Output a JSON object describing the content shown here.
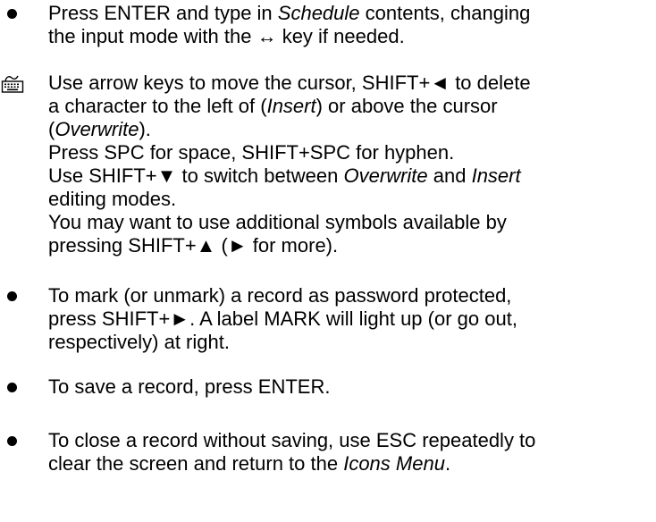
{
  "items": [
    {
      "kind": "bullet",
      "lines": [
        [
          {
            "t": "Press ENTER and type in "
          },
          {
            "t": "Schedule",
            "i": true
          },
          {
            "t": " contents, changing"
          }
        ],
        [
          {
            "t": "the input mode with the ↔ key if needed."
          }
        ]
      ]
    },
    {
      "kind": "keyboard",
      "icon": "keyboard-icon",
      "lines": [
        [
          {
            "t": "Use arrow keys to move the cursor, SHIFT+◄ to delete"
          }
        ],
        [
          {
            "t": "a character to the left of ("
          },
          {
            "t": "Insert",
            "i": true
          },
          {
            "t": ") or above the cursor"
          }
        ],
        [
          {
            "t": "("
          },
          {
            "t": "Overwrite",
            "i": true
          },
          {
            "t": ")."
          }
        ],
        [
          {
            "t": "Press SPC for space, SHIFT+SPC for hyphen."
          }
        ],
        [
          {
            "t": "Use SHIFT+▼ to switch between "
          },
          {
            "t": "Overwrite",
            "i": true
          },
          {
            "t": " and "
          },
          {
            "t": "Insert",
            "i": true
          }
        ],
        [
          {
            "t": "editing modes."
          }
        ],
        [
          {
            "t": "You may want to use additional symbols available by"
          }
        ],
        [
          {
            "t": "pressing SHIFT+▲ (► for more)."
          }
        ]
      ]
    },
    {
      "kind": "bullet",
      "lines": [
        [
          {
            "t": "To mark (or unmark) a record as password protected,"
          }
        ],
        [
          {
            "t": "press SHIFT+►. A label MARK will light up (or go out,"
          }
        ],
        [
          {
            "t": "respectively) at right."
          }
        ]
      ]
    },
    {
      "kind": "bullet",
      "lines": [
        [
          {
            "t": "To save a record, press ENTER."
          }
        ]
      ]
    },
    {
      "kind": "bullet",
      "lines": [
        [
          {
            "t": "To close a record without saving, use ESC repeatedly to"
          }
        ],
        [
          {
            "t": "clear the screen and return to the "
          },
          {
            "t": "Icons Menu",
            "i": true
          },
          {
            "t": "."
          }
        ]
      ]
    }
  ]
}
